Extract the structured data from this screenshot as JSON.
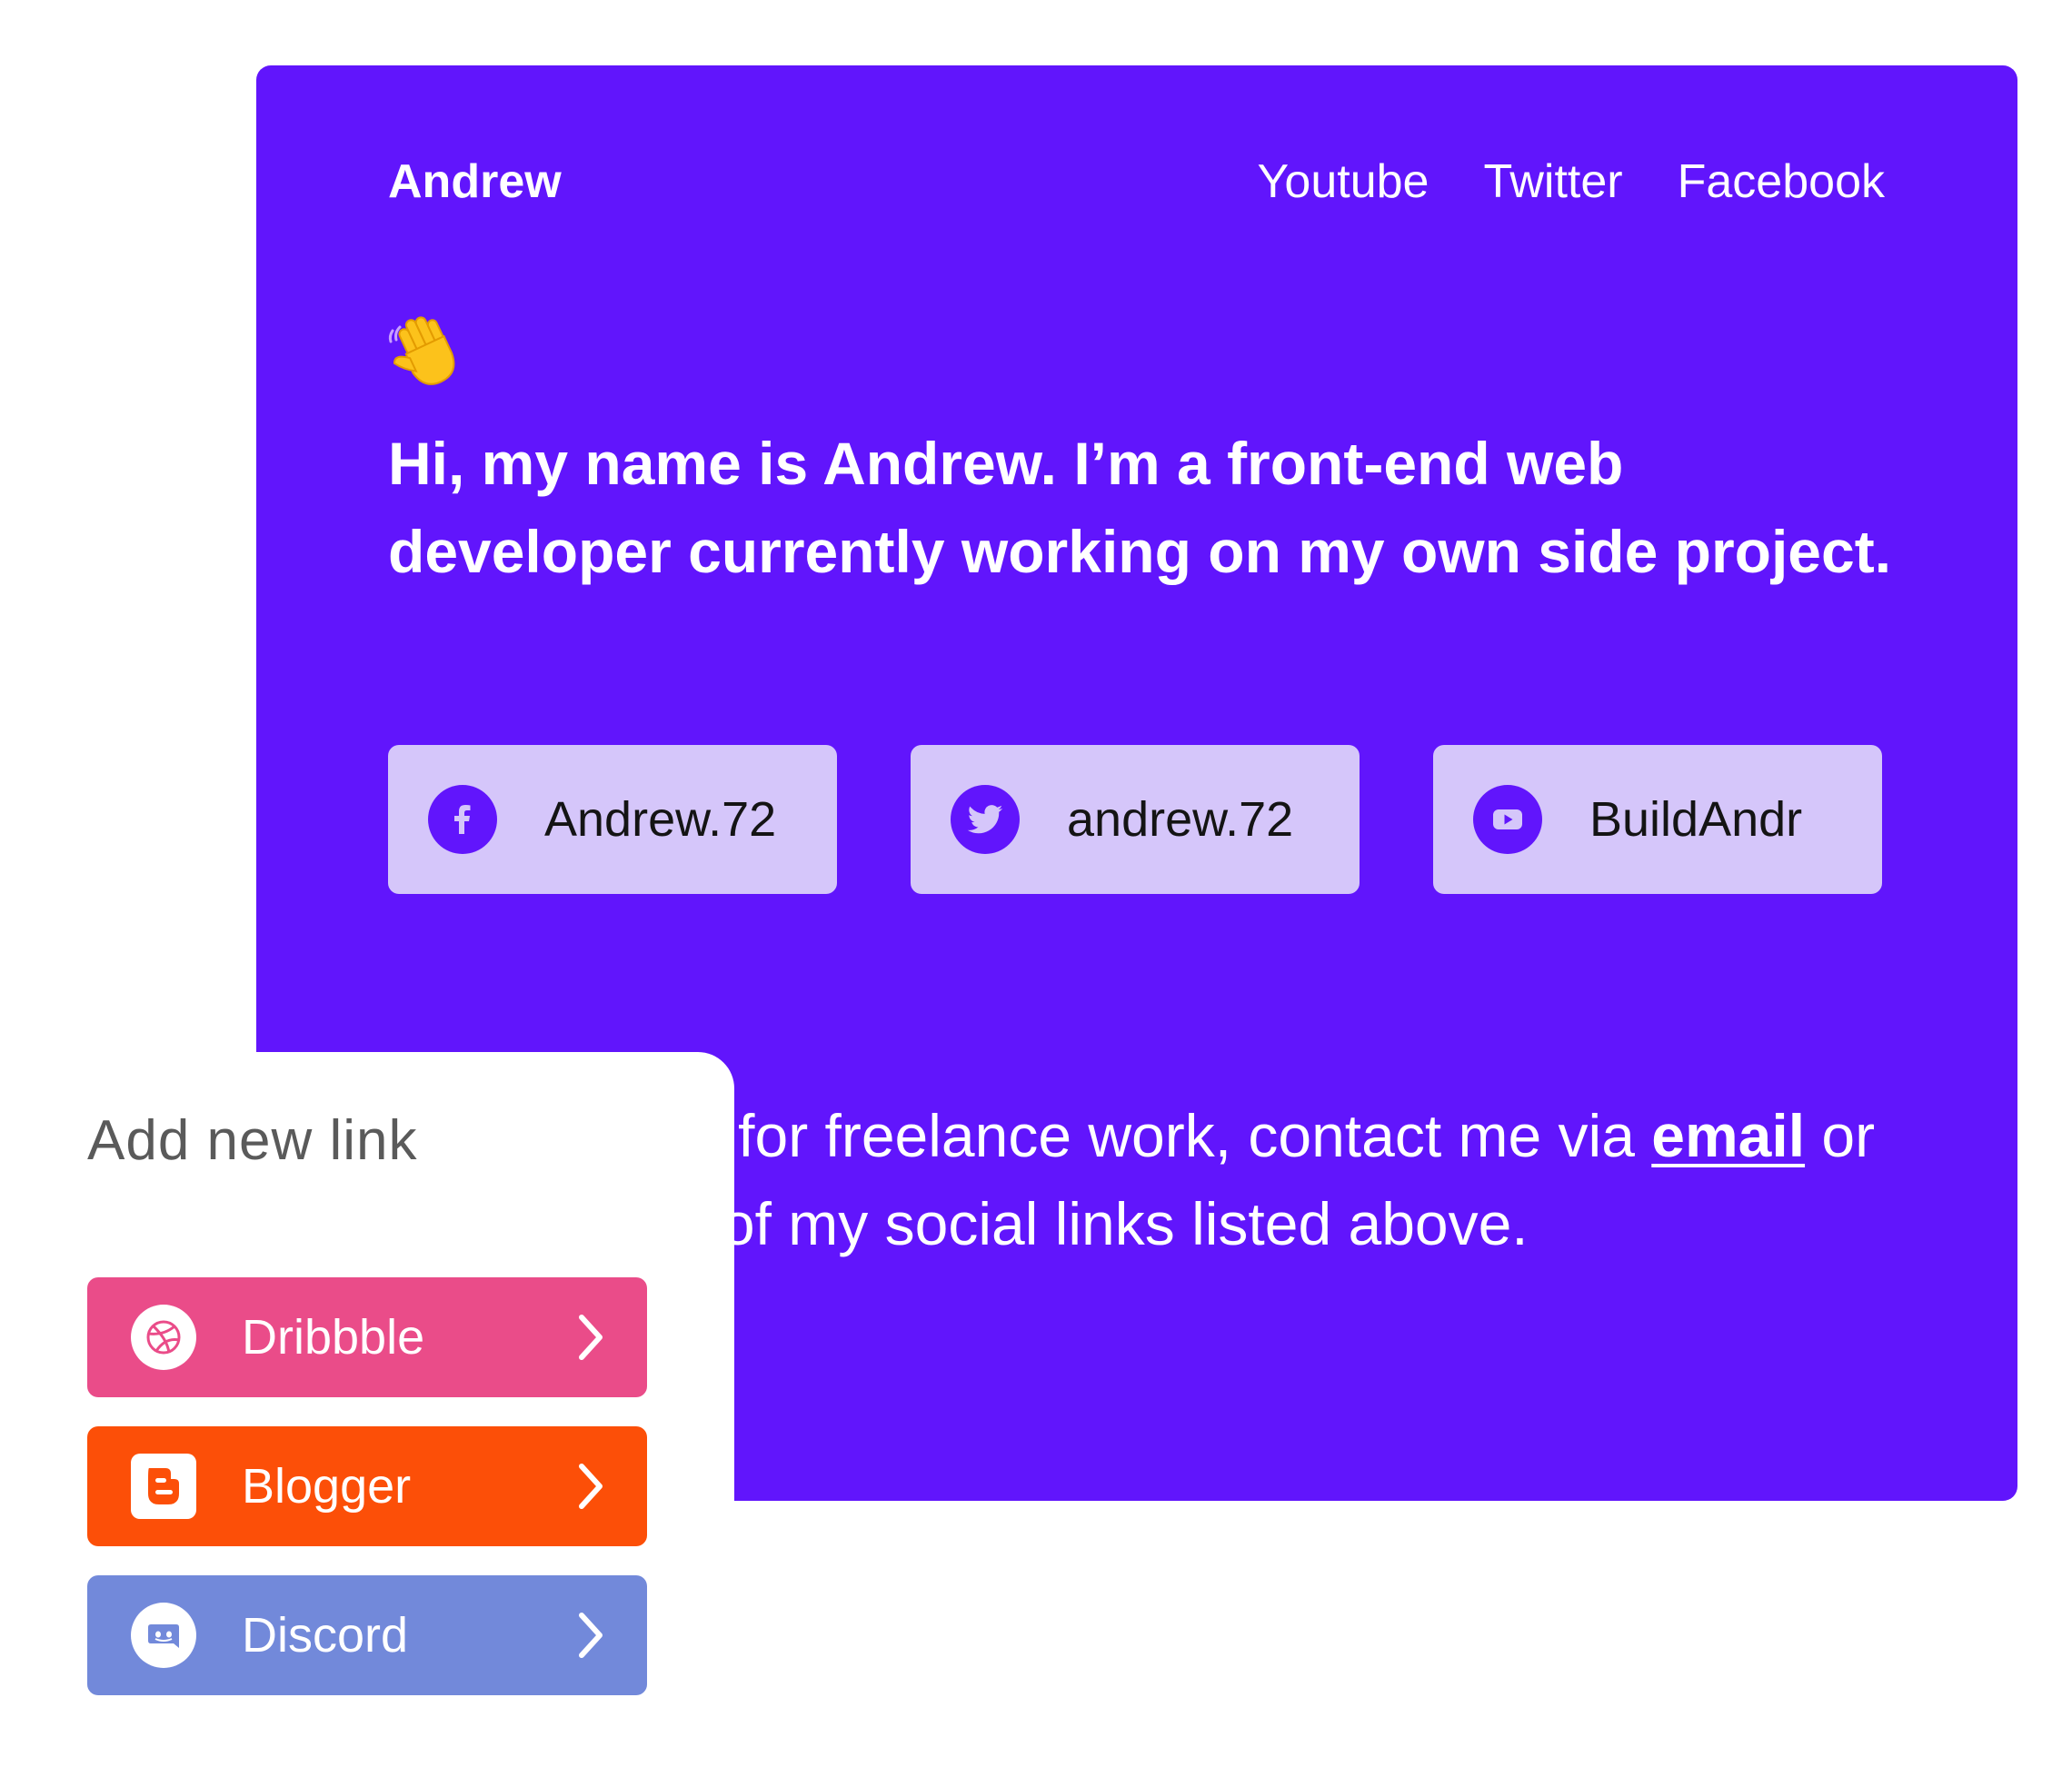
{
  "colors": {
    "card_bg": "#6115fc",
    "social_button_bg": "#d5c6fa",
    "dribbble": "#ea4c89",
    "blogger": "#fc4f08",
    "discord": "#7289da"
  },
  "header": {
    "brand": "Andrew",
    "nav": [
      "Youtube",
      "Twitter",
      "Facebook"
    ]
  },
  "hero": {
    "emoji": "waving-hand",
    "intro": "Hi, my name is Andrew. I’m a front-end web developer currently working on my own side project."
  },
  "socials": [
    {
      "icon": "facebook-icon",
      "label": "Andrew.72"
    },
    {
      "icon": "twitter-icon",
      "label": "andrew.72"
    },
    {
      "icon": "youtube-icon",
      "label": "BuildAndr"
    }
  ],
  "contact": {
    "before": "I’m available for freelance work, contact me via ",
    "link": "email",
    "after": " or through any of my social links listed above."
  },
  "add_link": {
    "title": "Add new link",
    "items": [
      {
        "label": "Dribbble",
        "icon": "dribbble-icon",
        "color": "#ea4c89"
      },
      {
        "label": "Blogger",
        "icon": "blogger-icon",
        "color": "#fc4f08"
      },
      {
        "label": "Discord",
        "icon": "discord-icon",
        "color": "#7289da"
      }
    ]
  }
}
